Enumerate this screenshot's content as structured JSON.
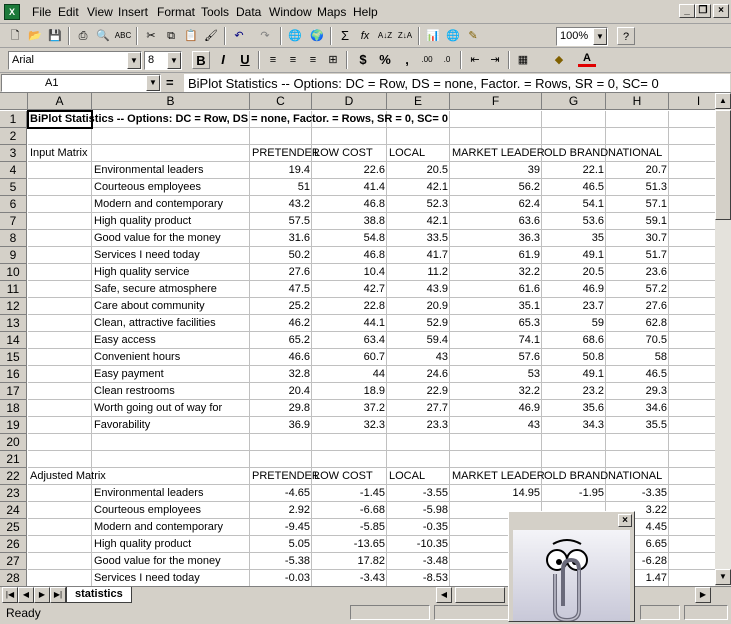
{
  "menu": {
    "items": [
      "File",
      "Edit",
      "View",
      "Insert",
      "Format",
      "Tools",
      "Data",
      "Window",
      "Maps",
      "Help"
    ]
  },
  "toolbar": {
    "zoom": "100%"
  },
  "format": {
    "font": "Arial",
    "size": "8"
  },
  "formula_bar": {
    "cell_ref": "A1",
    "content": "BiPlot Statistics -- Options:  DC = Row, DS = none, Factor. = Rows, SR = 0, SC= 0"
  },
  "columns": [
    "A",
    "B",
    "C",
    "D",
    "E",
    "F",
    "G",
    "H",
    "I"
  ],
  "rows": [
    "1",
    "2",
    "3",
    "4",
    "5",
    "6",
    "7",
    "8",
    "9",
    "10",
    "11",
    "12",
    "13",
    "14",
    "15",
    "16",
    "17",
    "18",
    "19",
    "20",
    "21",
    "22",
    "23",
    "24",
    "25",
    "26",
    "27",
    "28"
  ],
  "sheet": {
    "title": "BiPlot Statistics -- Options:  DC = Row, DS = none, Factor. = Rows, SR = 0, SC= 0",
    "i1_partial": "8/",
    "input_label": "Input Matrix",
    "adjusted_label": "Adjusted Matrix",
    "headers": [
      "PRETENDER",
      "LOW COST",
      "LOCAL",
      "MARKET LEADER",
      "OLD BRAND",
      "NATIONAL"
    ],
    "input_rows": [
      {
        "label": "Environmental leaders",
        "values": [
          "19.4",
          "22.6",
          "20.5",
          "39",
          "22.1",
          "20.7"
        ]
      },
      {
        "label": "Courteous employees",
        "values": [
          "51",
          "41.4",
          "42.1",
          "56.2",
          "46.5",
          "51.3"
        ]
      },
      {
        "label": "Modern and contemporary",
        "values": [
          "43.2",
          "46.8",
          "52.3",
          "62.4",
          "54.1",
          "57.1"
        ]
      },
      {
        "label": "High quality product",
        "values": [
          "57.5",
          "38.8",
          "42.1",
          "63.6",
          "53.6",
          "59.1"
        ]
      },
      {
        "label": "Good value for the money",
        "values": [
          "31.6",
          "54.8",
          "33.5",
          "36.3",
          "35",
          "30.7"
        ]
      },
      {
        "label": "Services I need today",
        "values": [
          "50.2",
          "46.8",
          "41.7",
          "61.9",
          "49.1",
          "51.7"
        ]
      },
      {
        "label": "High quality service",
        "values": [
          "27.6",
          "10.4",
          "11.2",
          "32.2",
          "20.5",
          "23.6"
        ]
      },
      {
        "label": "Safe, secure atmosphere",
        "values": [
          "47.5",
          "42.7",
          "43.9",
          "61.6",
          "46.9",
          "57.2"
        ]
      },
      {
        "label": "Care about community",
        "values": [
          "25.2",
          "22.8",
          "20.9",
          "35.1",
          "23.7",
          "27.6"
        ]
      },
      {
        "label": "Clean, attractive facilities",
        "values": [
          "46.2",
          "44.1",
          "52.9",
          "65.3",
          "59",
          "62.8"
        ]
      },
      {
        "label": "Easy access",
        "values": [
          "65.2",
          "63.4",
          "59.4",
          "74.1",
          "68.6",
          "70.5"
        ]
      },
      {
        "label": "Convenient hours",
        "values": [
          "46.6",
          "60.7",
          "43",
          "57.6",
          "50.8",
          "58"
        ]
      },
      {
        "label": "Easy payment",
        "values": [
          "32.8",
          "44",
          "24.6",
          "53",
          "49.1",
          "46.5"
        ]
      },
      {
        "label": "Clean restrooms",
        "values": [
          "20.4",
          "18.9",
          "22.9",
          "32.2",
          "23.2",
          "29.3"
        ]
      },
      {
        "label": "Worth going out of way for",
        "values": [
          "29.8",
          "37.2",
          "27.7",
          "46.9",
          "35.6",
          "34.6"
        ]
      },
      {
        "label": "Favorability",
        "values": [
          "36.9",
          "32.3",
          "23.3",
          "43",
          "34.3",
          "35.5"
        ]
      }
    ],
    "adjusted_rows": [
      {
        "label": "Environmental leaders",
        "values": [
          "-4.65",
          "-1.45",
          "-3.55",
          "14.95",
          "-1.95",
          "-3.35"
        ]
      },
      {
        "label": "Courteous employees",
        "values": [
          "2.92",
          "-6.68",
          "-5.98",
          "",
          "",
          "3.22"
        ]
      },
      {
        "label": "Modern and contemporary",
        "values": [
          "-9.45",
          "-5.85",
          "-0.35",
          "",
          "",
          "4.45"
        ]
      },
      {
        "label": "High quality product",
        "values": [
          "5.05",
          "-13.65",
          "-10.35",
          "",
          "",
          "6.65"
        ]
      },
      {
        "label": "Good value for the money",
        "values": [
          "-5.38",
          "17.82",
          "-3.48",
          "",
          "",
          "-6.28"
        ]
      },
      {
        "label": "Services I need today",
        "values": [
          "-0.03",
          "-3.43",
          "-8.53",
          "",
          "",
          "1.47"
        ]
      }
    ]
  },
  "tabs": {
    "active": "statistics"
  },
  "status": {
    "text": "Ready"
  }
}
